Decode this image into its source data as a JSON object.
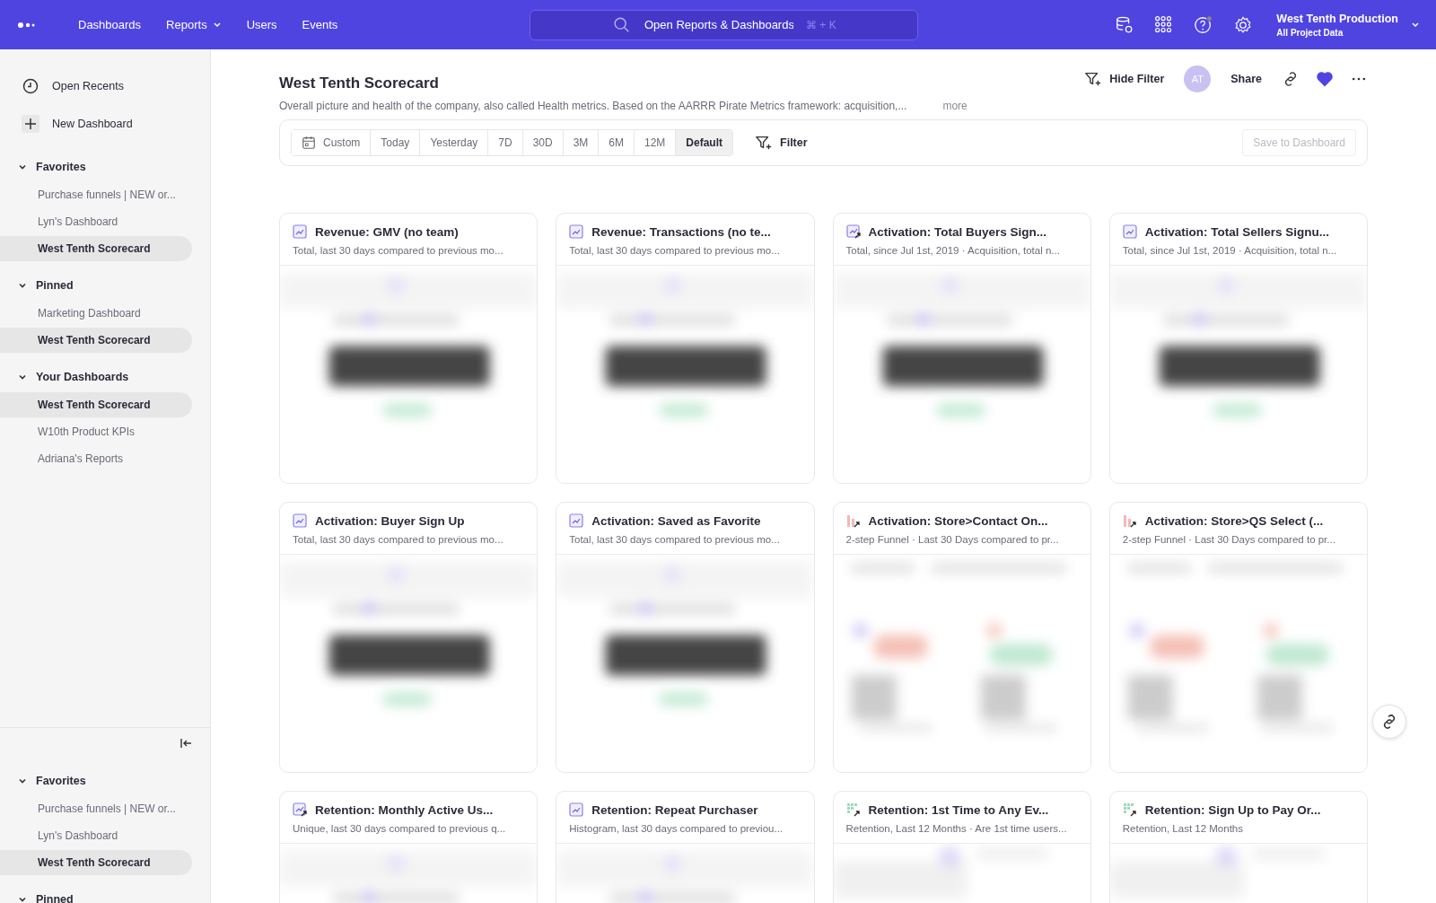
{
  "topbar": {
    "nav": [
      {
        "label": "Dashboards",
        "has_menu": false
      },
      {
        "label": "Reports",
        "has_menu": true
      },
      {
        "label": "Users",
        "has_menu": false
      },
      {
        "label": "Events",
        "has_menu": false
      }
    ],
    "search": {
      "placeholder": "Open Reports & Dashboards",
      "shortcut": "⌘ + K"
    },
    "project": {
      "name": "West Tenth Production",
      "scope": "All Project Data"
    }
  },
  "sidebar": {
    "actions": [
      {
        "kind": "recents",
        "label": "Open Recents"
      },
      {
        "kind": "new",
        "label": "New Dashboard"
      }
    ],
    "sections": [
      {
        "title": "Favorites",
        "expanded": true,
        "items": [
          {
            "label": "Purchase funnels | NEW or...",
            "selected": false
          },
          {
            "label": "Lyn's Dashboard",
            "selected": false
          },
          {
            "label": "West Tenth Scorecard",
            "selected": true
          }
        ]
      },
      {
        "title": "Pinned",
        "expanded": true,
        "items": [
          {
            "label": "Marketing Dashboard",
            "selected": false
          },
          {
            "label": "West Tenth Scorecard",
            "selected": true
          }
        ]
      },
      {
        "title": "Your Dashboards",
        "expanded": true,
        "items": [
          {
            "label": "West Tenth Scorecard",
            "selected": true
          },
          {
            "label": "W10th Product KPIs",
            "selected": false
          },
          {
            "label": "Adriana's Reports",
            "selected": false
          }
        ]
      }
    ],
    "bottom_sections": [
      {
        "title": "Favorites",
        "expanded": true,
        "items": [
          {
            "label": "Purchase funnels | NEW or...",
            "selected": false
          },
          {
            "label": "Lyn's Dashboard",
            "selected": false
          },
          {
            "label": "West Tenth Scorecard",
            "selected": true
          }
        ]
      },
      {
        "title": "Pinned",
        "expanded": true
      }
    ]
  },
  "dashboard": {
    "title": "West Tenth Scorecard",
    "description": "Overall picture and health of the company, also called Health metrics. Based on the AARRR Pirate Metrics framework: acquisition,...",
    "more": "more",
    "actions": {
      "hide_filter": "Hide Filter",
      "avatar": "AT",
      "share": "Share",
      "favorited": true
    },
    "ranges": [
      {
        "label": "Custom",
        "kind": "custom",
        "selected": false
      },
      {
        "label": "Today",
        "selected": false
      },
      {
        "label": "Yesterday",
        "selected": false
      },
      {
        "label": "7D",
        "selected": false
      },
      {
        "label": "30D",
        "selected": false
      },
      {
        "label": "3M",
        "selected": false
      },
      {
        "label": "6M",
        "selected": false
      },
      {
        "label": "12M",
        "selected": false
      },
      {
        "label": "Default",
        "selected": true
      }
    ],
    "filter": "Filter",
    "save": {
      "label": "Save to Dashboard",
      "disabled": true
    }
  },
  "cards": [
    {
      "kind": "insights",
      "title": "Revenue: GMV (no team)",
      "subtitle": "Total, last 30 days compared to previous mo..."
    },
    {
      "kind": "insights",
      "title": "Revenue: Transactions (no te...",
      "subtitle": "Total, last 30 days compared to previous mo..."
    },
    {
      "kind": "trend",
      "title": "Activation: Total Buyers Sign...",
      "subtitle": "Total, since Jul 1st, 2019 · Acquisition, total n..."
    },
    {
      "kind": "insights",
      "title": "Activation: Total Sellers Signu...",
      "subtitle": "Total, since Jul 1st, 2019 · Acquisition, total n..."
    },
    {
      "kind": "insights",
      "title": "Activation: Buyer Sign Up",
      "subtitle": "Total, last 30 days compared to previous mo..."
    },
    {
      "kind": "insights",
      "title": "Activation: Saved as Favorite",
      "subtitle": "Total, last 30 days compared to previous mo..."
    },
    {
      "kind": "funnel",
      "title": "Activation: Store>Contact On...",
      "subtitle": "2-step Funnel · Last 30 Days compared to pr..."
    },
    {
      "kind": "funnel",
      "title": "Activation: Store>QS Select (...",
      "subtitle": "2-step Funnel · Last 30 Days compared to pr..."
    },
    {
      "kind": "trend",
      "title": "Retention: Monthly Active Us...",
      "subtitle": "Unique, last 30 days compared to previous q..."
    },
    {
      "kind": "insights",
      "title": "Retention: Repeat Purchaser",
      "subtitle": "Histogram, last 30 days compared to previou..."
    },
    {
      "kind": "retention",
      "title": "Retention: 1st Time to Any Ev...",
      "subtitle": "Retention, Last 12 Months · Are 1st time users..."
    },
    {
      "kind": "retention",
      "title": "Retention: Sign Up to Pay Or...",
      "subtitle": "Retention, Last 12 Months"
    }
  ]
}
